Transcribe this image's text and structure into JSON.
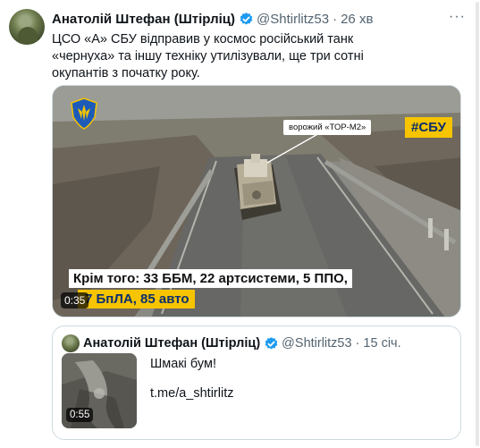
{
  "tweet": {
    "author_name": "Анатолій Штефан (Штірліц)",
    "handle": "@Shtirlitz53",
    "separator": "·",
    "time": "26 хв",
    "more_label": "···",
    "text": "ЦСО «А» СБУ відправив у космос російський танк «чернуха» та іншу техніку утилізували,  ще три сотні окупантів з початку року."
  },
  "video": {
    "label_tor": "ворожий «ТОР-М2»",
    "tag": "#СБУ",
    "caption_line1": "Крім того: 33 ББМ, 22 артсистеми, 5 ППО,",
    "caption_line2": "7 БпЛА, 85 авто",
    "duration": "0:35"
  },
  "quote": {
    "author_name": "Анатолій Штефан (Штірліц)",
    "handle": "@Shtirlitz53",
    "separator": "·",
    "time": "15 січ.",
    "line1": "Шмакі бум!",
    "line2": "t.me/a_shtirlitz",
    "duration": "0:55"
  },
  "colors": {
    "verified": "#1d9bf0",
    "sbu_yellow": "#f6c400",
    "sbu_blue": "#0b2e6e",
    "secondary_text": "#536471"
  },
  "icons": {
    "verified": "verified-badge-icon",
    "more": "more-dots-icon",
    "sbu": "sbu-emblem-icon"
  }
}
